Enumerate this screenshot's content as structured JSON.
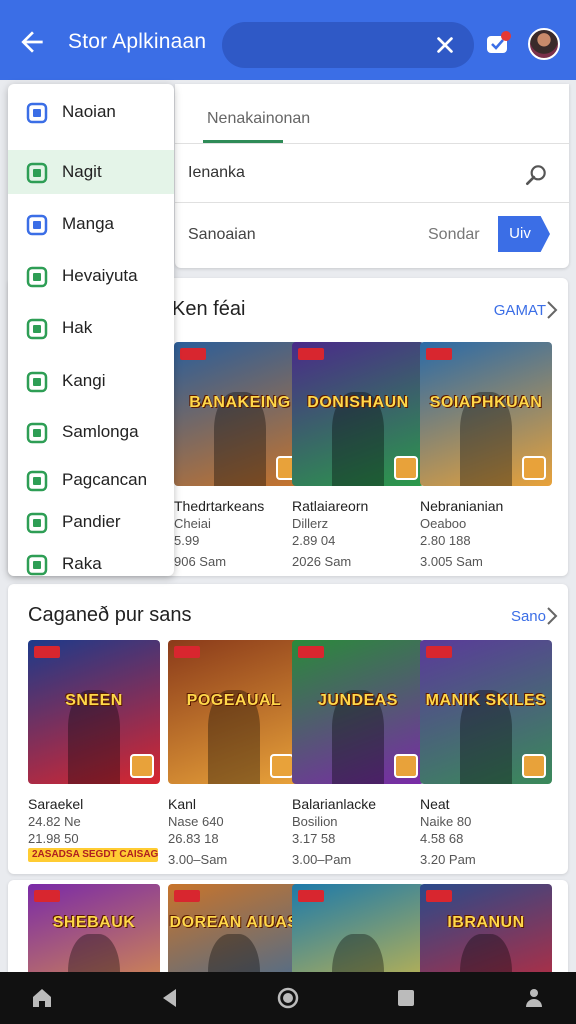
{
  "app_bar": {
    "title": "Stor Aplkinaan",
    "accent_color": "#3b6ee6",
    "back_icon": "arrow-left-icon",
    "clear_icon": "close-icon",
    "notification_icon": "chat-badge-icon",
    "avatar_icon": "user-avatar"
  },
  "search_panel": {
    "tab_label": "Nenakainonan",
    "query": "Ienanka",
    "search_icon": "search-icon",
    "sort_label": "Sanoaian",
    "sort_value": "Sondar",
    "go_label": "Uiv"
  },
  "drawer": {
    "items": [
      {
        "label": "Naoian",
        "icon": "group-icon",
        "color": "#3b6ee6",
        "active": false
      },
      {
        "label": "Nagit",
        "icon": "store-icon",
        "color": "#2e9e55",
        "active": true
      },
      {
        "label": "Manga",
        "icon": "grid-icon",
        "color": "#3b6ee6",
        "active": false
      },
      {
        "label": "Hevaiyuta",
        "icon": "layers-icon",
        "color": "#2e9e55",
        "active": false
      },
      {
        "label": "Hak",
        "icon": "trend-icon",
        "color": "#2e9e55",
        "active": false
      },
      {
        "label": "Kangi",
        "icon": "check-box-icon",
        "color": "#2e9e55",
        "active": false
      },
      {
        "label": "Samlonga",
        "icon": "search-circle-icon",
        "color": "#2e9e55",
        "active": false
      },
      {
        "label": "Pagcancan",
        "icon": "list-icon",
        "color": "#2e9e55",
        "active": false
      },
      {
        "label": "Pandier",
        "icon": "shield-icon",
        "color": "#2e9e55",
        "active": false
      },
      {
        "label": "Raka",
        "icon": "box-icon",
        "color": "#2e9e55",
        "active": false
      }
    ]
  },
  "section_1": {
    "title": "Ken féai",
    "more_label": "GAMAT",
    "tiles": [
      {
        "art_text": "BANAKEING",
        "name": "Thedrtarkeans",
        "meta": "Cheiai",
        "rating": "5.99",
        "price": "906 Sam",
        "colors": [
          "#2b5e9a",
          "#c8742b"
        ]
      },
      {
        "art_text": "DONISHAUN",
        "name": "Ratlaiareorn",
        "meta": "Dillerz",
        "rating": "2.89 04",
        "price": "2026 Sam",
        "colors": [
          "#4a2a8a",
          "#2b9a4a"
        ]
      },
      {
        "art_text": "SOIAPHKUAN",
        "name": "Nebranianian",
        "meta": "Oeaboo",
        "rating": "2.80 188",
        "price": "3.005 Sam",
        "colors": [
          "#2a6aa8",
          "#e8a23a"
        ]
      }
    ]
  },
  "section_2": {
    "title": "Caganeð pur sans",
    "more_label": "Sano",
    "sale_tag": "2ASADSA SEGDT CAISAGEN",
    "tiles": [
      {
        "art_text": "SNEEN",
        "name": "Saraekel",
        "meta": "24.82 Ne",
        "rating": "21.98 50",
        "price": "",
        "colors": [
          "#1d3a8a",
          "#d8262f"
        ]
      },
      {
        "art_text": "POGEAUAL",
        "name": "Kanl",
        "meta": "Nase 640",
        "rating": "26.83 18",
        "price": "3.00–Sam",
        "colors": [
          "#8a3a1a",
          "#e8a23a"
        ]
      },
      {
        "art_text": "JUNDEAS",
        "name": "Balarianlacke",
        "meta": "Bosilion",
        "rating": "3.17 58",
        "price": "3.00–Pam",
        "colors": [
          "#2a8a3a",
          "#7a2aa8"
        ]
      },
      {
        "art_text": "MANIK SKILES",
        "name": "Neat",
        "meta": "Naike 80",
        "rating": "4.58 68",
        "price": "3.20 Pam",
        "colors": [
          "#5a3a9a",
          "#3a8a5a"
        ]
      }
    ]
  },
  "section_3": {
    "tiles": [
      {
        "art_text": "SHEBAUK",
        "colors": [
          "#7a2aa8",
          "#e8a23a"
        ]
      },
      {
        "art_text": "DOREAN AIUAS",
        "colors": [
          "#c8742b",
          "#2a6aa8"
        ]
      },
      {
        "art_text": "",
        "colors": [
          "#1d7aaa",
          "#e8c23a"
        ]
      },
      {
        "art_text": "IBRANUN",
        "colors": [
          "#2a4a8a",
          "#d8262f"
        ]
      }
    ]
  },
  "bottom_nav": {
    "items": [
      "home-icon",
      "back-triangle-icon",
      "circle-home-icon",
      "square-recents-icon",
      "account-icon"
    ]
  }
}
